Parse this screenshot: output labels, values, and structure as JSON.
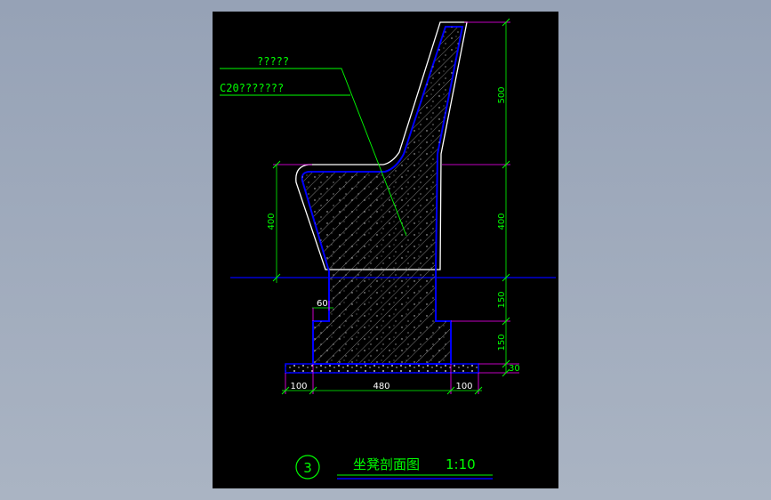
{
  "drawing": {
    "callouts": [
      "?????",
      "C20???????"
    ],
    "dimensions": {
      "back_height": "500",
      "seat_height": "400",
      "seat_height_left": "400",
      "stem_height": "150",
      "base_height": "150",
      "foundation_thickness": "30",
      "stem_offset": "60",
      "left_margin": "100",
      "base_width": "480",
      "right_margin": "100"
    },
    "title": {
      "number": "3",
      "name": "坐凳剖面图",
      "scale": "1:10"
    },
    "colors": {
      "background": "#000000",
      "outline": "#ffffff",
      "section": "#0000ff",
      "dimension": "#00ff00",
      "extension": "#ff00ff",
      "ground": "#0000ff"
    }
  }
}
